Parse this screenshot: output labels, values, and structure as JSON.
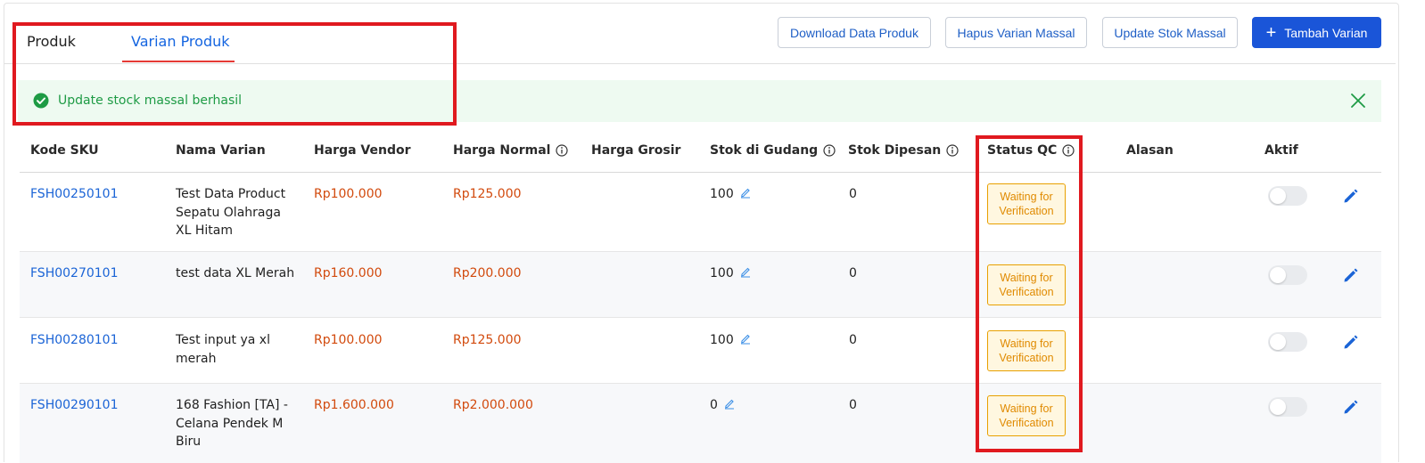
{
  "tabs": [
    {
      "label": "Produk",
      "active": false
    },
    {
      "label": "Varian Produk",
      "active": true
    }
  ],
  "toolbar": {
    "download_label": "Download Data Produk",
    "hapus_label": "Hapus Varian Massal",
    "update_label": "Update Stok Massal",
    "tambah_label": "Tambah Varian",
    "tambah_icon": "plus-icon"
  },
  "alert": {
    "message": "Update stock massal berhasil",
    "icon": "check-circle-icon",
    "close_icon": "close-icon",
    "color": "#1e9b45"
  },
  "table": {
    "headers": [
      "Kode SKU",
      "Nama Varian",
      "Harga Vendor",
      "Harga Normal",
      "Harga Grosir",
      "Stok di Gudang",
      "Stok Dipesan",
      "Status QC",
      "Alasan",
      "Aktif"
    ],
    "rows": [
      {
        "sku": "FSH00250101",
        "nama": [
          "Test Data Product",
          "Sepatu Olahraga",
          "XL Hitam"
        ],
        "vendor": "Rp100.000",
        "normal": "Rp125.000",
        "grosir": "",
        "stok": "100",
        "dipesan": "0",
        "status": [
          "Waiting for",
          "Verification"
        ],
        "alasan": "",
        "aktif": false
      },
      {
        "sku": "FSH00270101",
        "nama": [
          "test data XL Merah"
        ],
        "vendor": "Rp160.000",
        "normal": "Rp200.000",
        "grosir": "",
        "stok": "100",
        "dipesan": "0",
        "status": [
          "Waiting for",
          "Verification"
        ],
        "alasan": "",
        "aktif": false
      },
      {
        "sku": "FSH00280101",
        "nama": [
          "Test input ya xl",
          "merah"
        ],
        "vendor": "Rp100.000",
        "normal": "Rp125.000",
        "grosir": "",
        "stok": "100",
        "dipesan": "0",
        "status": [
          "Waiting for",
          "Verification"
        ],
        "alasan": "",
        "aktif": false
      },
      {
        "sku": "FSH00290101",
        "nama": [
          "168 Fashion [TA] -",
          "Celana Pendek M",
          "Biru"
        ],
        "vendor": "Rp1.600.000",
        "normal": "Rp2.000.000",
        "grosir": "",
        "stok": "0",
        "dipesan": "0",
        "status": [
          "Waiting for",
          "Verification"
        ],
        "alasan": "",
        "aktif": false
      }
    ]
  },
  "colors": {
    "accent": "#1a55d8",
    "price": "#d24a0d",
    "highlight": "#e0191f"
  }
}
